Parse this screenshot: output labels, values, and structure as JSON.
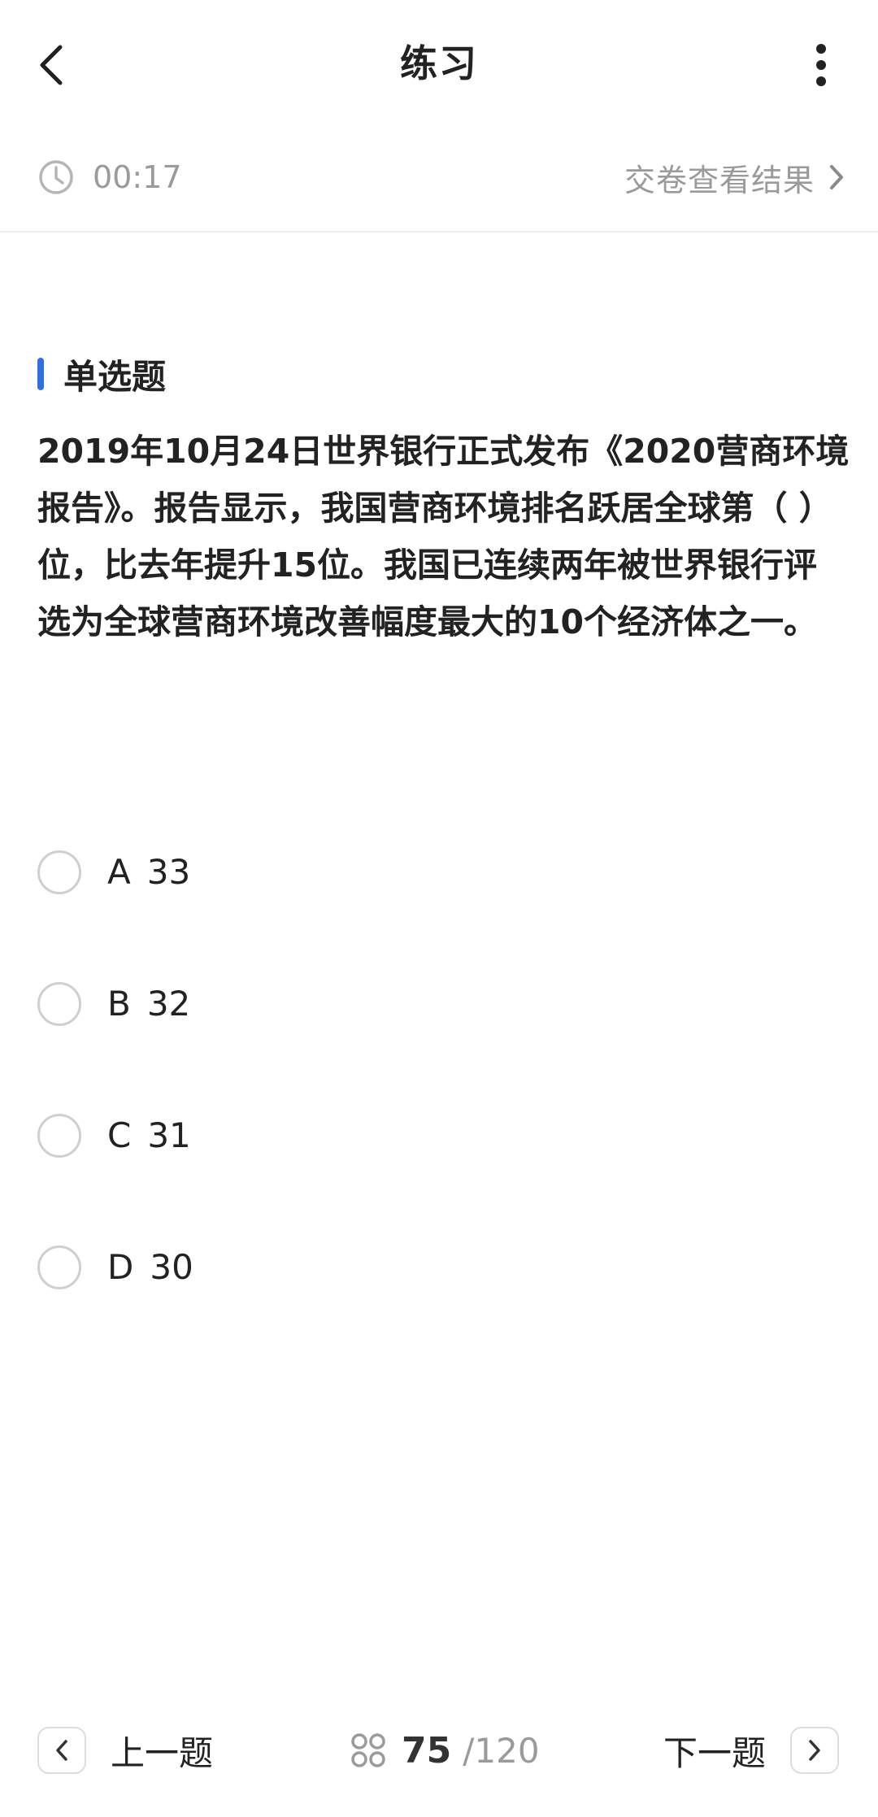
{
  "header": {
    "title": "练习"
  },
  "timer": {
    "elapsed": "00:17",
    "submit_label": "交卷查看结果"
  },
  "question": {
    "type_label": "单选题",
    "text": "2019年10月24日世界银行正式发布《2020营商环境报告》。报告显示，我国营商环境排名跃居全球第（ ）位，比去年提升15位。我国已连续两年被世界银行评选为全球营商环境改善幅度最大的10个经济体之一。",
    "options": [
      {
        "letter": "A",
        "value": "33"
      },
      {
        "letter": "B",
        "value": "32"
      },
      {
        "letter": "C",
        "value": "31"
      },
      {
        "letter": "D",
        "value": "30"
      }
    ]
  },
  "footer": {
    "prev_label": "上一题",
    "current": "75",
    "total": "/120",
    "next_label": "下一题"
  },
  "colors": {
    "accent": "#2f6fe0",
    "muted_text": "#9a9a9a",
    "primary_text": "#222222"
  }
}
